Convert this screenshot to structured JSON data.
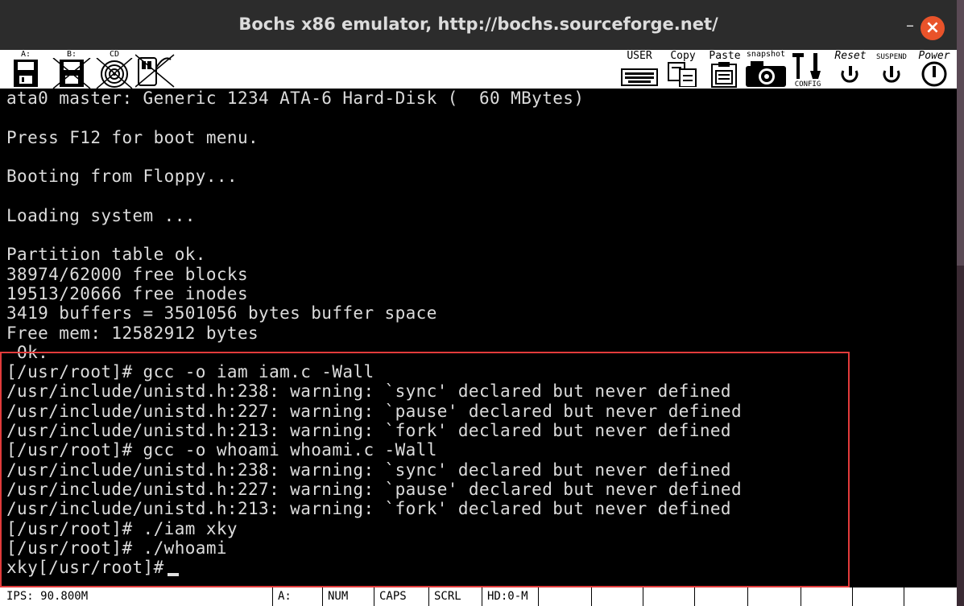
{
  "window": {
    "title": "Bochs x86 emulator, http://bochs.sourceforge.net/",
    "minimize_label": "–",
    "close_label": "×"
  },
  "toolbar": {
    "floppy_a": "A:",
    "floppy_b": "B:",
    "cdrom": "CD",
    "user": "USER",
    "copy": "Copy",
    "paste": "Paste",
    "snapshot": "snapshot",
    "config": "CONFIG",
    "reset": "Reset",
    "suspend": "SUSPEND",
    "power": "Power"
  },
  "terminal": {
    "lines": [
      "ata0 master: Generic 1234 ATA-6 Hard-Disk (  60 MBytes)",
      "",
      "Press F12 for boot menu.",
      "",
      "Booting from Floppy...",
      "",
      "Loading system ...",
      "",
      "Partition table ok.",
      "38974/62000 free blocks",
      "19513/20666 free inodes",
      "3419 buffers = 3501056 bytes buffer space",
      "Free mem: 12582912 bytes",
      " Ok.",
      "[/usr/root]# gcc -o iam iam.c -Wall",
      "/usr/include/unistd.h:238: warning: `sync' declared but never defined",
      "/usr/include/unistd.h:227: warning: `pause' declared but never defined",
      "/usr/include/unistd.h:213: warning: `fork' declared but never defined",
      "[/usr/root]# gcc -o whoami whoami.c -Wall",
      "/usr/include/unistd.h:238: warning: `sync' declared but never defined",
      "/usr/include/unistd.h:227: warning: `pause' declared but never defined",
      "/usr/include/unistd.h:213: warning: `fork' declared but never defined",
      "[/usr/root]# ./iam xky",
      "[/usr/root]# ./whoami",
      "xky[/usr/root]#"
    ]
  },
  "statusbar": {
    "ips": "IPS: 90.800M",
    "drive": "A:",
    "num": "NUM",
    "caps": "CAPS",
    "scrl": "SCRL",
    "hd": "HD:0-M"
  },
  "colors": {
    "highlight_border": "#e23b3b",
    "close_button": "#e9532a",
    "terminal_text": "#dcdcdc"
  }
}
